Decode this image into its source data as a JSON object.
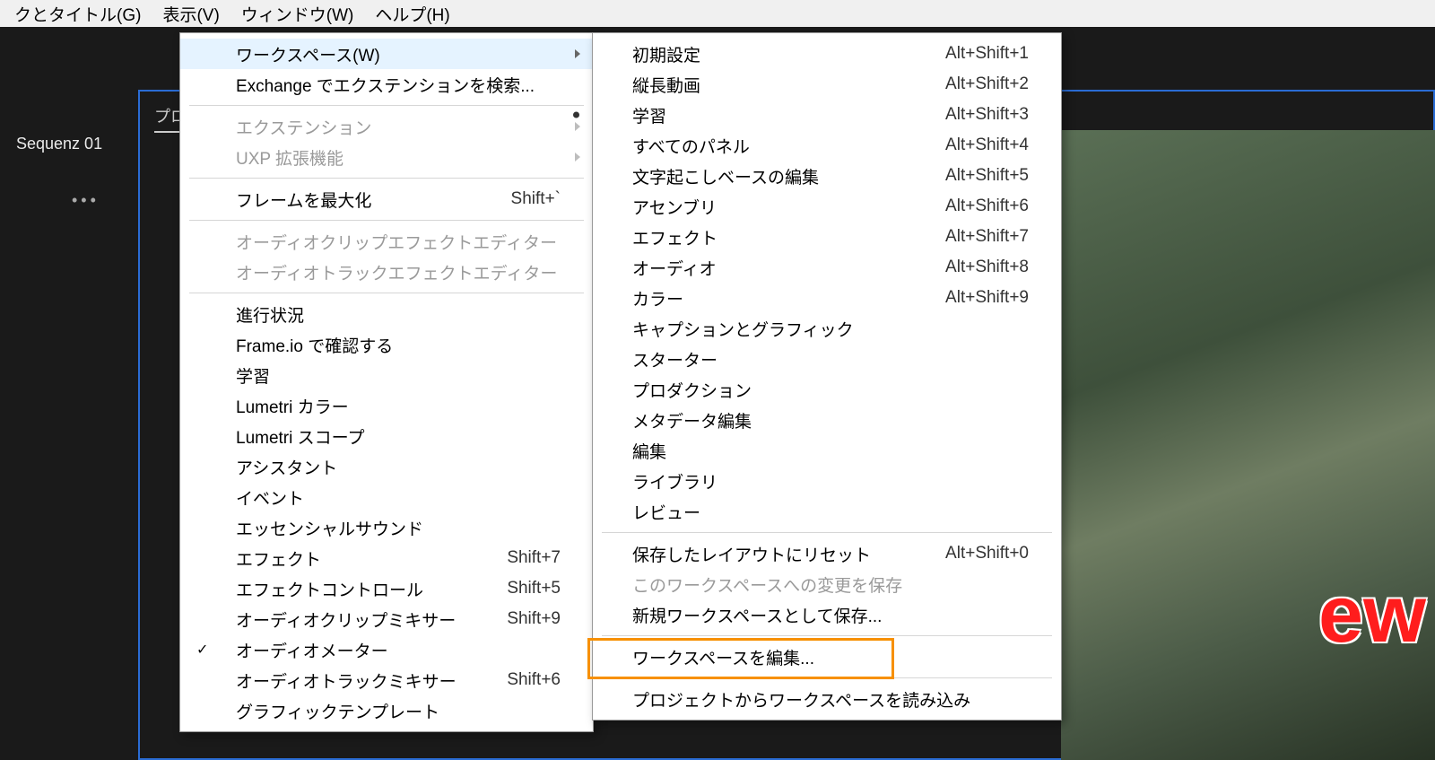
{
  "menubar": {
    "items": [
      {
        "label": "クとタイトル(G)"
      },
      {
        "label": "表示(V)"
      },
      {
        "label": "ウィンドウ(W)"
      },
      {
        "label": "ヘルプ(H)"
      }
    ]
  },
  "sidebar": {
    "sequence_label": "Sequenz 01",
    "dots": "•••",
    "panel_tab": "プロ"
  },
  "video": {
    "watermark": "ew"
  },
  "window_menu": {
    "items": [
      {
        "label": "ワークスペース(W)",
        "submenu": true,
        "highlight": true
      },
      {
        "label": "Exchange でエクステンションを検索..."
      },
      {
        "sep": true
      },
      {
        "label": "エクステンション",
        "submenu": true,
        "disabled": true
      },
      {
        "label": "UXP 拡張機能",
        "submenu": true,
        "disabled": true
      },
      {
        "sep": true
      },
      {
        "label": "フレームを最大化",
        "shortcut": "Shift+`"
      },
      {
        "sep": true
      },
      {
        "label": "オーディオクリップエフェクトエディター",
        "disabled": true
      },
      {
        "label": "オーディオトラックエフェクトエディター",
        "disabled": true
      },
      {
        "sep": true
      },
      {
        "label": "進行状況"
      },
      {
        "label": "Frame.io で確認する"
      },
      {
        "label": "学習"
      },
      {
        "label": "Lumetri カラー"
      },
      {
        "label": "Lumetri スコープ"
      },
      {
        "label": "アシスタント"
      },
      {
        "label": "イベント"
      },
      {
        "label": "エッセンシャルサウンド"
      },
      {
        "label": "エフェクト",
        "shortcut": "Shift+7"
      },
      {
        "label": "エフェクトコントロール",
        "shortcut": "Shift+5"
      },
      {
        "label": "オーディオクリップミキサー",
        "shortcut": "Shift+9"
      },
      {
        "label": "オーディオメーター",
        "checked": true
      },
      {
        "label": "オーディオトラックミキサー",
        "shortcut": "Shift+6"
      },
      {
        "label": "グラフィックテンプレート"
      }
    ]
  },
  "workspace_menu": {
    "items": [
      {
        "label": "初期設定",
        "shortcut": "Alt+Shift+1"
      },
      {
        "label": "縦長動画",
        "shortcut": "Alt+Shift+2"
      },
      {
        "label": "学習",
        "shortcut": "Alt+Shift+3",
        "current": true
      },
      {
        "label": "すべてのパネル",
        "shortcut": "Alt+Shift+4"
      },
      {
        "label": "文字起こしベースの編集",
        "shortcut": "Alt+Shift+5"
      },
      {
        "label": "アセンブリ",
        "shortcut": "Alt+Shift+6"
      },
      {
        "label": "エフェクト",
        "shortcut": "Alt+Shift+7"
      },
      {
        "label": "オーディオ",
        "shortcut": "Alt+Shift+8"
      },
      {
        "label": "カラー",
        "shortcut": "Alt+Shift+9"
      },
      {
        "label": "キャプションとグラフィック"
      },
      {
        "label": "スターター"
      },
      {
        "label": "プロダクション"
      },
      {
        "label": "メタデータ編集"
      },
      {
        "label": "編集"
      },
      {
        "label": "ライブラリ"
      },
      {
        "label": "レビュー"
      },
      {
        "sep": true
      },
      {
        "label": "保存したレイアウトにリセット",
        "shortcut": "Alt+Shift+0"
      },
      {
        "label": "このワークスペースへの変更を保存",
        "disabled": true
      },
      {
        "label": "新規ワークスペースとして保存..."
      },
      {
        "sep": true
      },
      {
        "label": "ワークスペースを編集...",
        "outlined": true
      },
      {
        "sep": true
      },
      {
        "label": "プロジェクトからワークスペースを読み込み"
      }
    ]
  }
}
